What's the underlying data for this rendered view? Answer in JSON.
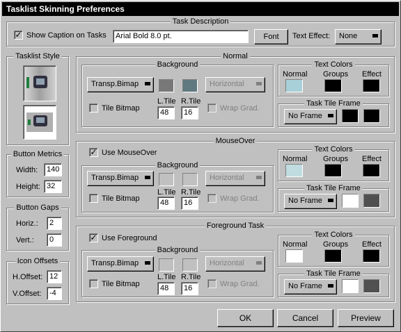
{
  "window": {
    "title": "Tasklist Skinning Preferences"
  },
  "task_description": {
    "title": "Task Description",
    "show_caption_label": "Show Caption on Tasks",
    "show_caption_checked": "✓",
    "font_value": "Arial Bold 8.0 pt.",
    "font_button": "Font",
    "text_effect_label": "Text Effect:",
    "text_effect_value": "None"
  },
  "tasklist_style": {
    "title": "Tasklist Style"
  },
  "button_metrics": {
    "title": "Button Metrics",
    "width_label": "Width:",
    "width_value": "140",
    "height_label": "Height:",
    "height_value": "32"
  },
  "button_gaps": {
    "title": "Button Gaps",
    "horiz_label": "Horiz.:",
    "horiz_value": "2",
    "vert_label": "Vert.:",
    "vert_value": "0"
  },
  "icon_offsets": {
    "title": "Icon Offsets",
    "h_label": "H.Offset:",
    "h_value": "12",
    "v_label": "V.Offset:",
    "v_value": "-4"
  },
  "normal": {
    "title": "Normal",
    "background_title": "Background",
    "bitmap_mode": "Transp.Bimap",
    "gradient": "Horizontal",
    "tile_bitmap": "Tile Bitmap",
    "ltile_label": "L.Tile",
    "ltile_value": "48",
    "rtile_label": "R.Tile",
    "rtile_value": "16",
    "wrap_grad": "Wrap Grad.",
    "text_colors_title": "Text Colors",
    "col_normal": "Normal",
    "col_groups": "Groups",
    "col_effect": "Effect",
    "frame_title": "Task Tile Frame",
    "frame_value": "No Frame",
    "colors": {
      "bg1": "#787878",
      "bg2": "#607880",
      "normal": "#a8d0d8",
      "groups": "#000000",
      "effect": "#000000",
      "frame1": "#000000",
      "frame2": "#000000"
    }
  },
  "mouseover": {
    "title": "MouseOver",
    "use_label": "Use MouseOver",
    "use_checked": "✓",
    "background_title": "Background",
    "bitmap_mode": "Transp.Bimap",
    "gradient": "Horizontal",
    "tile_bitmap": "Tile Bitmap",
    "ltile_label": "L.Tile",
    "ltile_value": "48",
    "rtile_label": "R.Tile",
    "rtile_value": "16",
    "wrap_grad": "Wrap Grad.",
    "text_colors_title": "Text Colors",
    "col_normal": "Normal",
    "col_groups": "Groups",
    "col_effect": "Effect",
    "frame_title": "Task Tile Frame",
    "frame_value": "No Frame",
    "colors": {
      "normal": "#c0dce0",
      "groups": "#000000",
      "effect": "#000000",
      "frame1": "#ffffff",
      "frame2": "#505050"
    }
  },
  "foreground": {
    "title": "Foreground Task",
    "use_label": "Use Foreground",
    "use_checked": "✓",
    "background_title": "Background",
    "bitmap_mode": "Transp.Bimap",
    "gradient": "Horizontal",
    "tile_bitmap": "Tile Bitmap",
    "ltile_label": "L.Tile",
    "ltile_value": "48",
    "rtile_label": "R.Tile",
    "rtile_value": "16",
    "wrap_grad": "Wrap Grad.",
    "text_colors_title": "Text Colors",
    "col_normal": "Normal",
    "col_groups": "Groups",
    "col_effect": "Effect",
    "frame_title": "Task Tile Frame",
    "frame_value": "No Frame",
    "colors": {
      "normal": "#ffffff",
      "groups": "#000000",
      "effect": "#000000",
      "frame1": "#ffffff",
      "frame2": "#505050"
    }
  },
  "buttons": {
    "ok": "OK",
    "cancel": "Cancel",
    "preview": "Preview"
  }
}
